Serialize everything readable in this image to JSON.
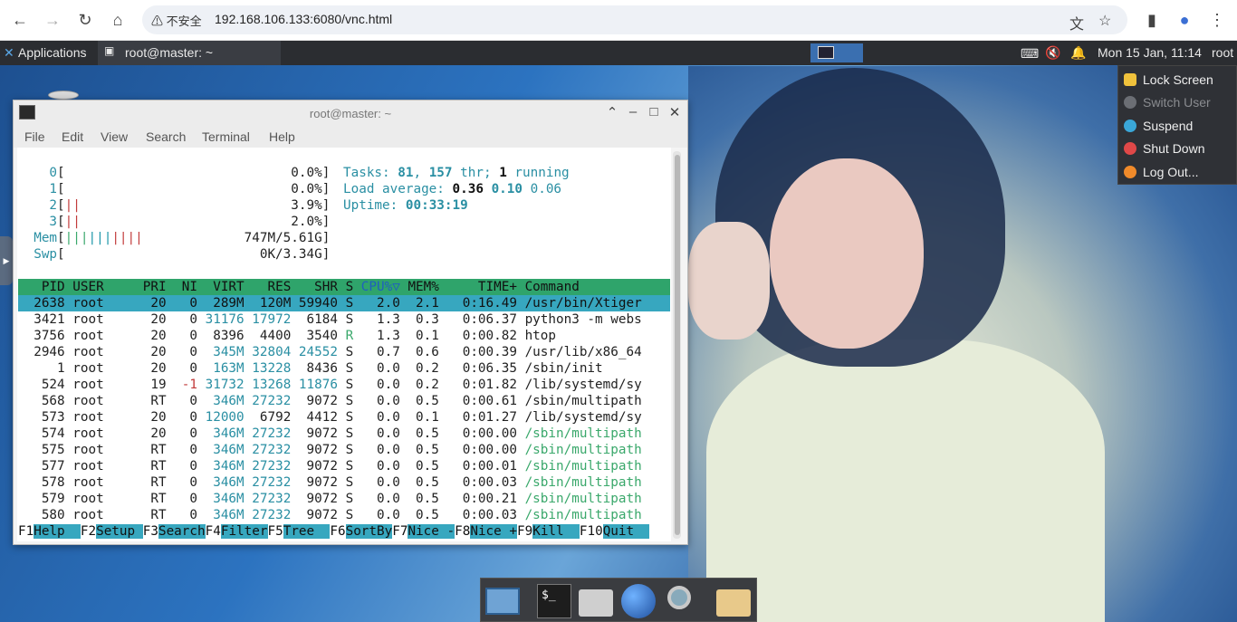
{
  "browser": {
    "back": "←",
    "forward": "→",
    "reload": "↻",
    "home": "⌂",
    "security_warning": "不安全",
    "url": "192.168.106.133:6080/vnc.html",
    "icons": [
      "translate-icon",
      "star-icon",
      "sidepanel-icon",
      "profile-icon",
      "menu-icon"
    ]
  },
  "panel": {
    "applications": "Applications",
    "task_title": "root@master: ~",
    "clock": "Mon 15 Jan, 11:14",
    "user": "root"
  },
  "user_menu": {
    "items": [
      {
        "label": "Lock Screen",
        "enabled": true,
        "color": "#f0c23c"
      },
      {
        "label": "Switch User",
        "enabled": false,
        "color": "#8a8c90"
      },
      {
        "label": "Suspend",
        "enabled": true,
        "color": "#3aa7d8"
      },
      {
        "label": "Shut Down",
        "enabled": true,
        "color": "#e04848"
      },
      {
        "label": "Log Out...",
        "enabled": true,
        "color": "#f08a2a"
      }
    ]
  },
  "terminal": {
    "title": "root@master: ~",
    "menu": [
      "File",
      "Edit",
      "View",
      "Search",
      "Terminal",
      "Help"
    ],
    "cpu": [
      {
        "id": "0",
        "bar": "",
        "pct": "0.0%"
      },
      {
        "id": "1",
        "bar": "",
        "pct": "0.0%"
      },
      {
        "id": "2",
        "bar": "||",
        "pct": "3.9%"
      },
      {
        "id": "3",
        "bar": "||",
        "pct": "2.0%"
      }
    ],
    "mem": {
      "label": "Mem",
      "bar": "||||||||||",
      "value": "747M/5.61G"
    },
    "swp": {
      "label": "Swp",
      "bar": "",
      "value": "0K/3.34G"
    },
    "tasks_label": "Tasks:",
    "tasks": "81",
    "threads": "157",
    "thr_label": "thr;",
    "running": "1",
    "running_label": "running",
    "load_label": "Load average:",
    "load1": "0.36",
    "load5": "0.10",
    "load15": "0.06",
    "uptime_label": "Uptime:",
    "uptime": "00:33:19",
    "header": [
      "PID",
      "USER",
      "PRI",
      "NI",
      "VIRT",
      "RES",
      "SHR",
      "S",
      "CPU%▽",
      "MEM%",
      "TIME+",
      "Command"
    ],
    "rows": [
      [
        "2638",
        "root",
        "20",
        "0",
        "289M",
        "120M",
        "59940",
        "S",
        "2.0",
        "2.1",
        "0:16.49",
        "/usr/bin/Xtiger"
      ],
      [
        "3421",
        "root",
        "20",
        "0",
        "31176",
        "17972",
        "6184",
        "S",
        "1.3",
        "0.3",
        "0:06.37",
        "python3 -m webs"
      ],
      [
        "3756",
        "root",
        "20",
        "0",
        "8396",
        "4400",
        "3540",
        "R",
        "1.3",
        "0.1",
        "0:00.82",
        "htop"
      ],
      [
        "2946",
        "root",
        "20",
        "0",
        "345M",
        "32804",
        "24552",
        "S",
        "0.7",
        "0.6",
        "0:00.39",
        "/usr/lib/x86_64"
      ],
      [
        "1",
        "root",
        "20",
        "0",
        "163M",
        "13228",
        "8436",
        "S",
        "0.0",
        "0.2",
        "0:06.35",
        "/sbin/init"
      ],
      [
        "524",
        "root",
        "19",
        "-1",
        "31732",
        "13268",
        "11876",
        "S",
        "0.0",
        "0.2",
        "0:01.82",
        "/lib/systemd/sy"
      ],
      [
        "568",
        "root",
        "RT",
        "0",
        "346M",
        "27232",
        "9072",
        "S",
        "0.0",
        "0.5",
        "0:00.61",
        "/sbin/multipath"
      ],
      [
        "573",
        "root",
        "20",
        "0",
        "12000",
        "6792",
        "4412",
        "S",
        "0.0",
        "0.1",
        "0:01.27",
        "/lib/systemd/sy"
      ],
      [
        "574",
        "root",
        "20",
        "0",
        "346M",
        "27232",
        "9072",
        "S",
        "0.0",
        "0.5",
        "0:00.00",
        "/sbin/multipath"
      ],
      [
        "575",
        "root",
        "RT",
        "0",
        "346M",
        "27232",
        "9072",
        "S",
        "0.0",
        "0.5",
        "0:00.00",
        "/sbin/multipath"
      ],
      [
        "577",
        "root",
        "RT",
        "0",
        "346M",
        "27232",
        "9072",
        "S",
        "0.0",
        "0.5",
        "0:00.01",
        "/sbin/multipath"
      ],
      [
        "578",
        "root",
        "RT",
        "0",
        "346M",
        "27232",
        "9072",
        "S",
        "0.0",
        "0.5",
        "0:00.03",
        "/sbin/multipath"
      ],
      [
        "579",
        "root",
        "RT",
        "0",
        "346M",
        "27232",
        "9072",
        "S",
        "0.0",
        "0.5",
        "0:00.21",
        "/sbin/multipath"
      ],
      [
        "580",
        "root",
        "RT",
        "0",
        "346M",
        "27232",
        "9072",
        "S",
        "0.0",
        "0.5",
        "0:00.03",
        "/sbin/multipath"
      ]
    ],
    "fkeys": [
      {
        "key": "F1",
        "label": "Help  "
      },
      {
        "key": "F2",
        "label": "Setup "
      },
      {
        "key": "F3",
        "label": "Search"
      },
      {
        "key": "F4",
        "label": "Filter"
      },
      {
        "key": "F5",
        "label": "Tree  "
      },
      {
        "key": "F6",
        "label": "SortBy"
      },
      {
        "key": "F7",
        "label": "Nice -"
      },
      {
        "key": "F8",
        "label": "Nice +"
      },
      {
        "key": "F9",
        "label": "Kill  "
      },
      {
        "key": "F10",
        "label": "Quit  "
      }
    ]
  },
  "dock": {
    "items": [
      "show-desktop-icon",
      "terminal-icon",
      "home-folder-icon",
      "web-browser-icon",
      "search-icon",
      "files-icon"
    ],
    "terminal_glyph": "$_"
  }
}
